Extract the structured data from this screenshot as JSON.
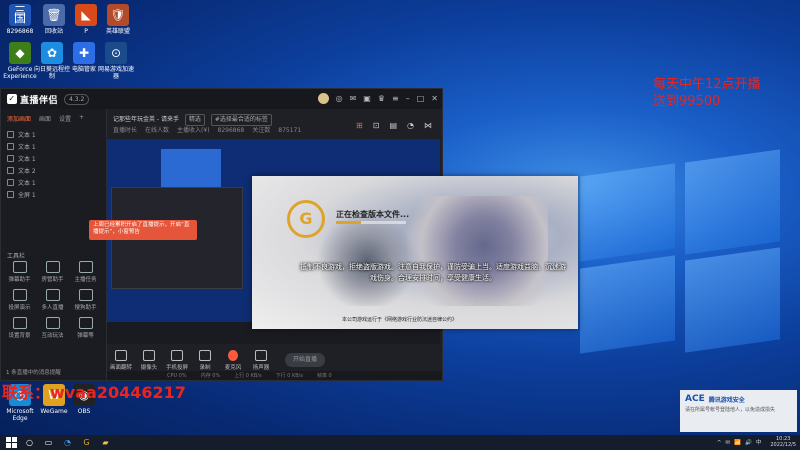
{
  "desktop": {
    "icons": [
      {
        "label": "8296868",
        "glyph": "三国",
        "color": "#1f55b4"
      },
      {
        "label": "回收站",
        "glyph": "🗑",
        "color": "#4a6aa8"
      },
      {
        "label": "P",
        "glyph": "◣",
        "color": "#d84a1a"
      },
      {
        "label": "英雄联盟",
        "glyph": "🛡",
        "color": "#b34a2a"
      },
      {
        "label": "GeForce Experience",
        "glyph": "◆",
        "color": "#3e7e1a"
      },
      {
        "label": "向日葵远程控制",
        "glyph": "✿",
        "color": "#1c8de0"
      },
      {
        "label": "电脑管家",
        "glyph": "✚",
        "color": "#2d6ee6"
      },
      {
        "label": "网易游戏加速器",
        "glyph": "⊙",
        "color": "#1a4c8c"
      },
      {
        "label": "Microsoft Edge",
        "glyph": "◔",
        "color": "#1b8ad4"
      },
      {
        "label": "WeGame",
        "glyph": "W",
        "color": "#e0a020"
      },
      {
        "label": "OBS",
        "glyph": "◉",
        "color": "#222222"
      }
    ],
    "overlay_lines": [
      "每天中午12点开播",
      "送到99500"
    ],
    "contact": "联系：wvaa20446217"
  },
  "app": {
    "title": "直播伴侣",
    "badge": "4.3.2",
    "sidebar": {
      "tabs": [
        "添加画面",
        "画面",
        "设置"
      ],
      "scenes": [
        "文本 1",
        "文本 1",
        "文本 1",
        "文本 2",
        "文本 1",
        "全屏 1"
      ],
      "alert": "上周已经累积开启了直播提示，开启“直播提示”，小窗预告",
      "tools_label": "工具栏",
      "tools": [
        "弹幕助手",
        "房管助手",
        "主播任务",
        "投屏演示",
        "多人直播",
        "搜狗助手",
        "设置背景",
        "互动玩法",
        "弹幕等"
      ],
      "footer": "1 条直播中的消息提醒"
    },
    "stream_info": {
      "title": "记那些年玩金英 - 请来手",
      "tag": "精选",
      "extra": "#选择最合适的标签",
      "row2": [
        "直播时长",
        "在线人数",
        "主播收入(¥)",
        "8296868",
        "关注数",
        "875171"
      ]
    },
    "bottom_buttons": [
      "画面翻转",
      "摄像头",
      "手机投屏",
      "录制",
      "麦克风",
      "扬声器"
    ],
    "start_label": "开始直播",
    "status": [
      "CPU 0%",
      "内存 0%",
      "上行 0 KB/s",
      "下行 0 KB/s",
      "帧率 0"
    ]
  },
  "loader": {
    "emblem": "G",
    "status": "正在检查版本文件...",
    "progress_fraction": 0.35,
    "notice": "抵制不良游戏，拒绝盗版游戏。注意自我保护，谨防受骗上当。适度游戏益脑，沉迷游戏伤身。合理安排时间，享受健康生活。",
    "approval": "本公司游戏运行于《网络游戏行业防沉迷自律公约》"
  },
  "toast": {
    "title": "腾讯游戏安全",
    "body": "请在所属号帐号登陆他人，以免造成损失"
  },
  "taskbar": {
    "time": "10:23",
    "date": "2022/12/5",
    "tray_icons": [
      "^",
      "✉",
      "📶",
      "🔊",
      "中"
    ]
  }
}
